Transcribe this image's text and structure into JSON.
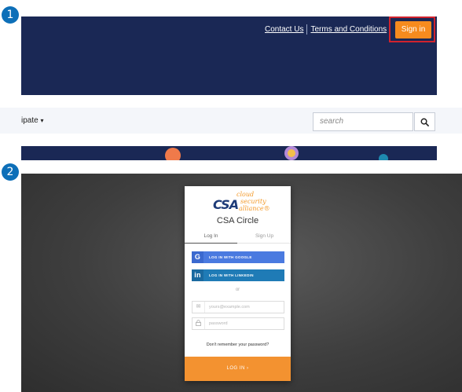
{
  "steps": {
    "first": "1",
    "second": "2"
  },
  "panel1": {
    "header": {
      "links": [
        "Contact Us",
        "Terms and Conditions"
      ],
      "signin_label": "Sign in"
    },
    "nav": {
      "partial_item": "ipate",
      "caret": "▾"
    },
    "search": {
      "placeholder": "search",
      "button_icon": "search-icon"
    },
    "colors": {
      "navy": "#1a2855",
      "accent": "#f68b1e",
      "highlight": "#d1222d"
    }
  },
  "panel2": {
    "logo": {
      "abbrev": "CSA",
      "line1": "cloud",
      "line2": "security",
      "line3": "alliance®"
    },
    "title": "CSA Circle",
    "tabs": {
      "login": "Log In",
      "signup": "Sign Up"
    },
    "social": {
      "google_icon": "G",
      "google_label": "LOG IN WITH GOOGLE",
      "linkedin_icon": "in",
      "linkedin_label": "LOG IN WITH LINKEDIN"
    },
    "or_text": "or",
    "email": {
      "icon": "mail-icon",
      "placeholder": "yours@example.com"
    },
    "password": {
      "icon": "lock-icon",
      "placeholder": "password"
    },
    "forgot_text": "Don't remember your password?",
    "login_button": "LOG IN ›",
    "colors": {
      "brand_blue": "#1f3c78",
      "brand_orange": "#f39a2b",
      "google": "#4a7ae0",
      "linkedin": "#1f7bb6",
      "login": "#f39230"
    }
  }
}
